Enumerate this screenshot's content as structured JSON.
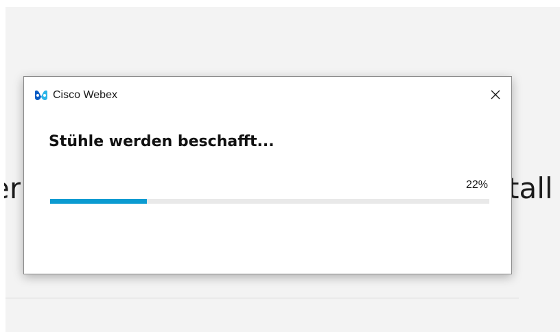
{
  "background": {
    "text_left": "er",
    "text_right": "tall"
  },
  "dialog": {
    "app_title": "Cisco Webex",
    "app_icon": "webex-logo-icon",
    "close_icon": "close-icon",
    "heading": "Stühle werden beschafft...",
    "progress_label": "22%",
    "progress": 0.22,
    "accent_color": "#0b9bd1"
  }
}
